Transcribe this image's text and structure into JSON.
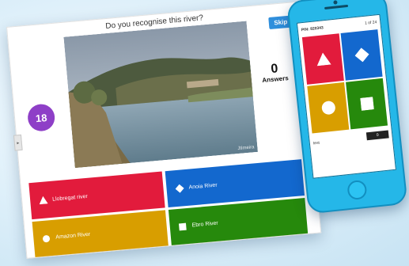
{
  "quiz": {
    "question": "Do you recognise this river?",
    "skip_label": "Skip",
    "timer": "18",
    "answers_count": "0",
    "answers_label": "Answers",
    "image_credit": "Jtimeira",
    "tab_glyph": "▸",
    "options": [
      {
        "label": "Llobregat river",
        "shape": "triangle",
        "color": "#e21b3c"
      },
      {
        "label": "Anoia River",
        "shape": "diamond",
        "color": "#1368ce"
      },
      {
        "label": "Amazon River",
        "shape": "circle",
        "color": "#d89e00"
      },
      {
        "label": "Ebro River",
        "shape": "square",
        "color": "#26890c"
      }
    ],
    "timer_color": "#8e3fc7",
    "skip_color": "#2f8fdc"
  },
  "phone": {
    "pin": "PIN: 820343",
    "progress": "1 of 24",
    "player_name": "test",
    "score": "0",
    "case_color": "#25b7e8"
  }
}
